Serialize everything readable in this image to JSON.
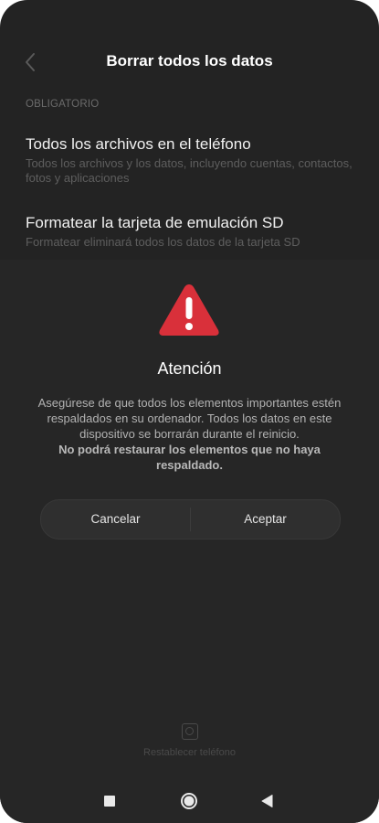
{
  "header": {
    "title": "Borrar todos los datos",
    "back_icon": "chevron-left-icon"
  },
  "section": {
    "label": "OBLIGATORIO"
  },
  "options": [
    {
      "title": "Todos los archivos en el teléfono",
      "description": "Todos los archivos y los datos, incluyendo cuentas, contactos, fotos y aplicaciones"
    },
    {
      "title": "Formatear la tarjeta de emulación SD",
      "description": "Formatear eliminará todos los datos de la tarjeta SD"
    }
  ],
  "dialog": {
    "icon": "warning-triangle-icon",
    "title": "Atención",
    "body": "Asegúrese de que todos los elementos importantes estén respaldados en su ordenador. Todos los datos en este dispositivo se borrarán durante el reinicio.",
    "bold_text": "No podrá restaurar los elementos que no haya respaldado.",
    "cancel_label": "Cancelar",
    "accept_label": "Aceptar"
  },
  "footer": {
    "reset_label": "Restablecer teléfono",
    "reset_icon": "reset-phone-icon"
  },
  "navbar": {
    "recents_icon": "square-icon",
    "home_icon": "circle-icon",
    "back_icon": "triangle-left-icon"
  },
  "colors": {
    "background": "#232323",
    "warning": "#d9303a",
    "text_primary": "#ffffff",
    "text_muted": "#b2b2b2"
  }
}
